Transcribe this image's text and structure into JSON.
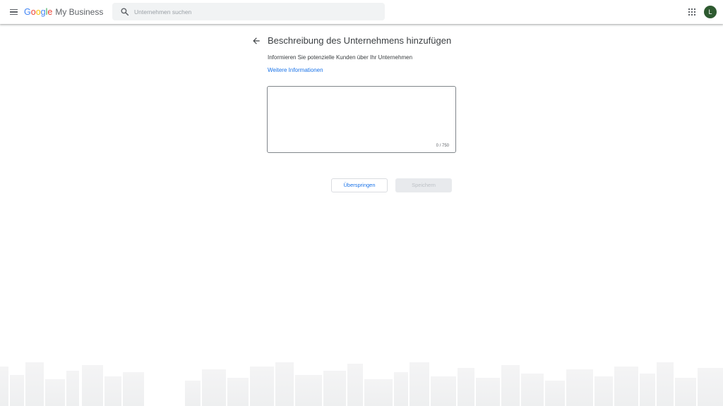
{
  "header": {
    "menu_icon": "hamburger-menu-icon",
    "brand": {
      "letters": [
        {
          "char": "G",
          "color": "#4285F4"
        },
        {
          "char": "o",
          "color": "#EA4335"
        },
        {
          "char": "o",
          "color": "#FBBC05"
        },
        {
          "char": "g",
          "color": "#4285F4"
        },
        {
          "char": "l",
          "color": "#34A853"
        },
        {
          "char": "e",
          "color": "#EA4335"
        }
      ],
      "product": "My Business"
    },
    "search": {
      "icon": "search-icon",
      "placeholder": "Unternehmen suchen"
    },
    "apps_icon": "apps-grid-icon",
    "avatar": {
      "initial": "L",
      "color": "#2e5a30"
    }
  },
  "main": {
    "back_icon": "arrow-back-icon",
    "title": "Beschreibung des Unternehmens hinzufügen",
    "subtitle": "Informieren Sie potenzielle Kunden über Ihr Unternehmen",
    "more_link": "Weitere Informationen",
    "description": {
      "value": "",
      "counter": "0 / 750"
    },
    "buttons": {
      "skip": "Überspringen",
      "save": "Speichern"
    }
  },
  "colors": {
    "accent": "#1a73e8",
    "disabled_bg": "#e8eaed",
    "disabled_text": "#bdc1c6"
  }
}
